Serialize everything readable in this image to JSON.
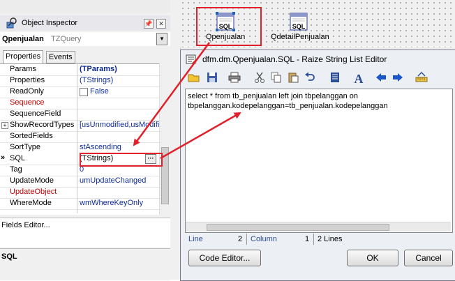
{
  "object_inspector": {
    "title": "Object Inspector",
    "pin_glyph": "📌",
    "close_glyph": "✕",
    "component_name": "Qpenjualan",
    "component_type": "TZQuery",
    "tabs": [
      "Properties",
      "Events"
    ],
    "rows": [
      {
        "name": "Params",
        "value": "(TParams)",
        "name_red": false,
        "value_style": "bold"
      },
      {
        "name": "Properties",
        "value": "(TStrings)",
        "name_red": false,
        "value_style": "normal"
      },
      {
        "name": "ReadOnly",
        "value": "False",
        "name_red": false,
        "value_style": "normal",
        "checkbox": true
      },
      {
        "name": "Sequence",
        "value": "",
        "name_red": true,
        "value_style": "normal"
      },
      {
        "name": "SequenceField",
        "value": "",
        "name_red": false,
        "value_style": "normal"
      },
      {
        "name": "ShowRecordTypes",
        "value": "[usUnmodified,usModifi",
        "name_red": false,
        "value_style": "normal",
        "expand": "+"
      },
      {
        "name": "SortedFields",
        "value": "",
        "name_red": false,
        "value_style": "normal"
      },
      {
        "name": "SortType",
        "value": "stAscending",
        "name_red": false,
        "value_style": "normal"
      },
      {
        "name": "SQL",
        "value": "(TStrings)",
        "name_red": false,
        "value_style": "black",
        "selected": true,
        "pointer": "»",
        "ellipsis": "···"
      },
      {
        "name": "Tag",
        "value": "0",
        "name_red": false,
        "value_style": "normal"
      },
      {
        "name": "UpdateMode",
        "value": "umUpdateChanged",
        "name_red": false,
        "value_style": "normal"
      },
      {
        "name": "UpdateObject",
        "value": "",
        "name_red": true,
        "value_style": "normal"
      },
      {
        "name": "WhereMode",
        "value": "wmWhereKeyOnly",
        "name_red": false,
        "value_style": "normal"
      }
    ],
    "fields_editor": "Fields Editor...",
    "sql_label": "SQL"
  },
  "form": {
    "components": [
      {
        "label": "Qpenjualan",
        "icon_text": "SQL"
      },
      {
        "label": "QdetailPenjualan",
        "icon_text": "SQL"
      }
    ]
  },
  "editor": {
    "title": "dfm.dm.Qpenjualan.SQL - Raize String List Editor",
    "lines": [
      "select * from tb_penjualan left join tbpelanggan on",
      "tbpelanggan.kodepelanggan=tb_penjualan.kodepelanggan"
    ],
    "status": {
      "line_label": "Line",
      "line_value": "2",
      "column_label": "Column",
      "column_value": "1",
      "lines_text": "2 Lines"
    },
    "buttons": {
      "code_editor": "Code Editor...",
      "ok": "OK",
      "cancel": "Cancel"
    }
  },
  "colors": {
    "highlight": "#e0202a",
    "value_text": "#102c99",
    "required_text": "#c00000"
  }
}
